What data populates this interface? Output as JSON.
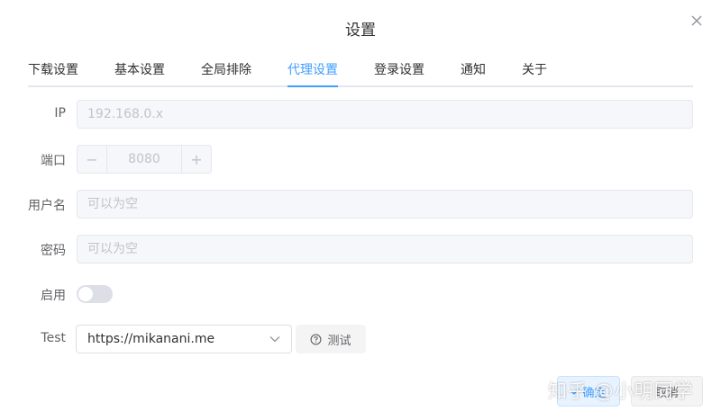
{
  "dialog": {
    "title": "设置"
  },
  "tabs": [
    {
      "label": "下载设置",
      "active": false
    },
    {
      "label": "基本设置",
      "active": false
    },
    {
      "label": "全局排除",
      "active": false
    },
    {
      "label": "代理设置",
      "active": true
    },
    {
      "label": "登录设置",
      "active": false
    },
    {
      "label": "通知",
      "active": false
    },
    {
      "label": "关于",
      "active": false
    }
  ],
  "form": {
    "ip": {
      "label": "IP",
      "placeholder": "192.168.0.x"
    },
    "port": {
      "label": "端口",
      "value": "8080",
      "minus": "−",
      "plus": "+"
    },
    "username": {
      "label": "用户名",
      "placeholder": "可以为空"
    },
    "password": {
      "label": "密码",
      "placeholder": "可以为空"
    },
    "enable": {
      "label": "启用",
      "on": false
    },
    "test": {
      "label": "Test",
      "selected": "https://mikanani.me",
      "button_label": "测试"
    }
  },
  "footer": {
    "confirm_label": "确定",
    "cancel_label": "取消"
  },
  "watermark": {
    "text": "知乎 @小明同学"
  },
  "colors": {
    "accent": "#409eff",
    "border": "#e4e7ed",
    "disabled_bg": "#f5f7fa",
    "text": "#303133"
  }
}
